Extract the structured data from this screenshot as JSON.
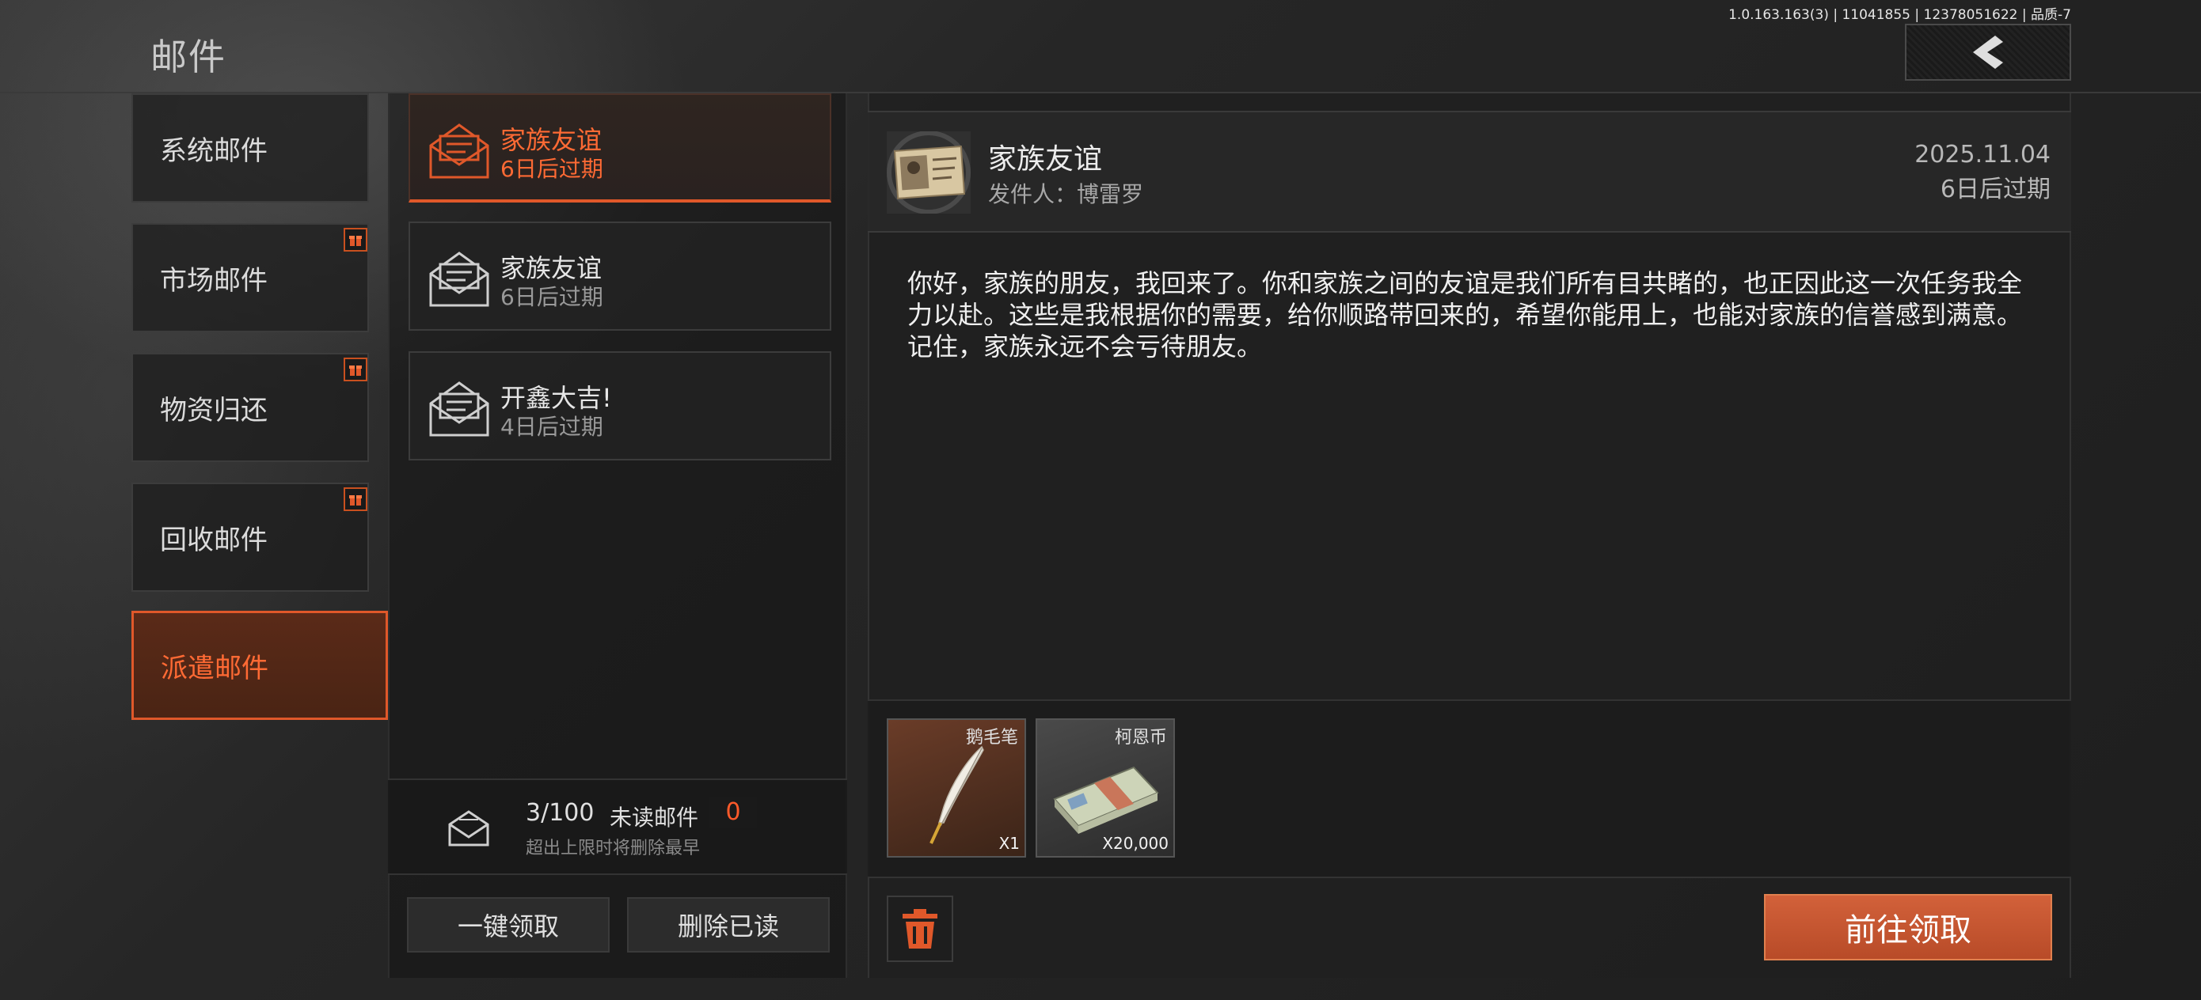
{
  "header": {
    "title": "邮件",
    "version": "1.0.163.163(3) | 11041855 | 12378051622 | 品质-7"
  },
  "categories": [
    {
      "label": "系统邮件",
      "has_gift_badge": false,
      "active": false
    },
    {
      "label": "市场邮件",
      "has_gift_badge": true,
      "active": false
    },
    {
      "label": "物资归还",
      "has_gift_badge": true,
      "active": false
    },
    {
      "label": "回收邮件",
      "has_gift_badge": true,
      "active": false
    },
    {
      "label": "派遣邮件",
      "has_gift_badge": false,
      "active": true
    }
  ],
  "mail_list": [
    {
      "title": "家族友谊",
      "expiry": "6日后过期",
      "selected": true,
      "icon": "envelope-icon"
    },
    {
      "title": "家族友谊",
      "expiry": "6日后过期",
      "selected": false,
      "icon": "envelope-icon"
    },
    {
      "title": "开鑫大吉!",
      "expiry": "4日后过期",
      "selected": false,
      "icon": "envelope-icon"
    }
  ],
  "stats": {
    "count": "3/100",
    "unread_label": "未读邮件",
    "unread_count": "0",
    "note": "超出上限时将删除最早"
  },
  "actions": {
    "bulk_claim": "一键领取",
    "delete_read": "删除已读",
    "claim": "前往领取"
  },
  "detail": {
    "title": "家族友谊",
    "sender": "发件人：博雷罗",
    "date": "2025.11.04",
    "expiry": "6日后过期",
    "body": "你好，家族的朋友，我回来了。你和家族之间的友谊是我们所有目共睹的，也正因此这一次任务我全力以赴。这些是我根据你的需要，给你顺路带回来的，希望你能用上，也能对家族的信誉感到满意。记住，家族永远不会亏待朋友。"
  },
  "attachments": [
    {
      "name": "鹅毛笔",
      "qty": "X1",
      "icon": "quill-icon"
    },
    {
      "name": "柯恩币",
      "qty": "X20,000",
      "icon": "cash-stack-icon"
    }
  ],
  "colors": {
    "accent": "#e0582a",
    "accent_text": "#ff6a34",
    "claim_button": "#c4552f"
  }
}
